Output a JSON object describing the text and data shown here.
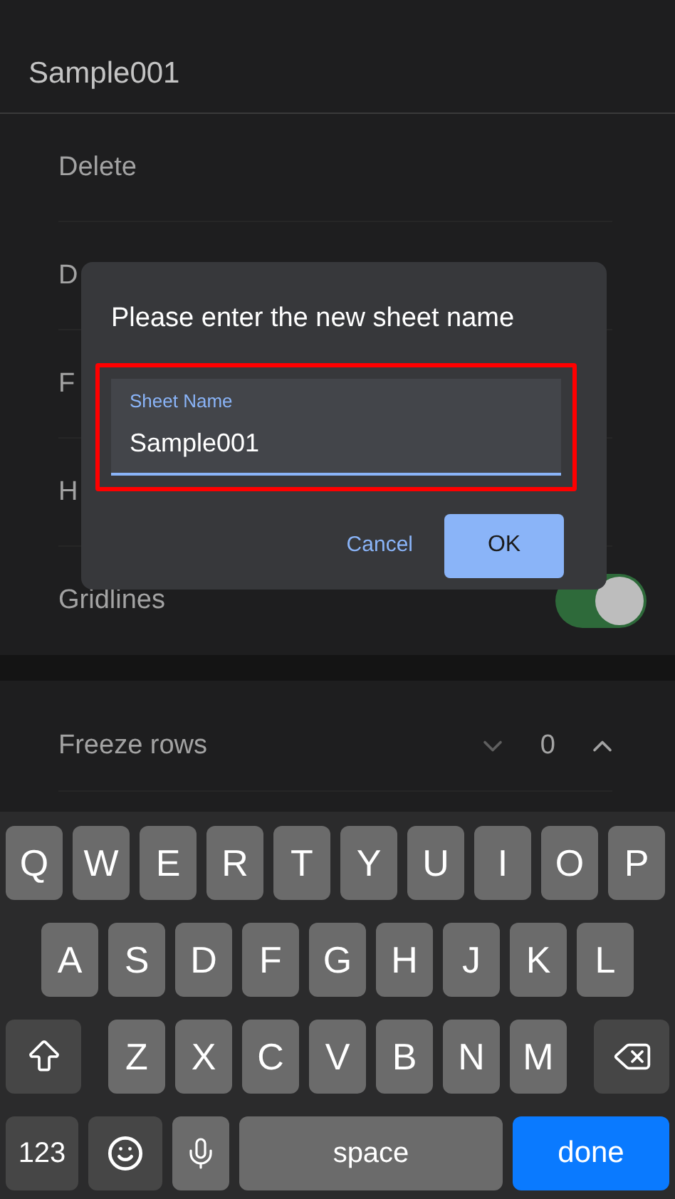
{
  "header": {
    "title": "Sample001"
  },
  "menu": [
    {
      "kind": "text",
      "label": "Delete"
    },
    {
      "kind": "text",
      "label": "D"
    },
    {
      "kind": "text",
      "label": "F"
    },
    {
      "kind": "text",
      "label": "H"
    },
    {
      "kind": "toggle",
      "label": "Gridlines",
      "on": true
    }
  ],
  "dialog": {
    "title": "Please enter the new sheet name",
    "highlighted": true,
    "field": {
      "label": "Sheet Name",
      "value": "Sample001"
    },
    "buttons": [
      {
        "kind": "text",
        "label": "Cancel"
      },
      {
        "kind": "filled",
        "label": "OK"
      }
    ]
  },
  "freeze_rows": {
    "label": "Freeze rows",
    "value": "0"
  },
  "keyboard": {
    "top_row": [
      {
        "kind": "letter",
        "label": "Q"
      },
      {
        "kind": "letter",
        "label": "W"
      },
      {
        "kind": "letter",
        "label": "E"
      },
      {
        "kind": "letter",
        "label": "R"
      },
      {
        "kind": "letter",
        "label": "T"
      },
      {
        "kind": "letter",
        "label": "Y"
      },
      {
        "kind": "letter",
        "label": "U"
      },
      {
        "kind": "letter",
        "label": "I"
      },
      {
        "kind": "letter",
        "label": "O"
      },
      {
        "kind": "letter",
        "label": "P"
      }
    ],
    "middle_row": [
      {
        "kind": "letter",
        "label": "A"
      },
      {
        "kind": "letter",
        "label": "S"
      },
      {
        "kind": "letter",
        "label": "D"
      },
      {
        "kind": "letter",
        "label": "F"
      },
      {
        "kind": "letter",
        "label": "G"
      },
      {
        "kind": "letter",
        "label": "H"
      },
      {
        "kind": "letter",
        "label": "J"
      },
      {
        "kind": "letter",
        "label": "K"
      },
      {
        "kind": "letter",
        "label": "L"
      }
    ],
    "lower_row": [
      {
        "kind": "shift"
      },
      {
        "kind": "letter",
        "label": "Z"
      },
      {
        "kind": "letter",
        "label": "X"
      },
      {
        "kind": "letter",
        "label": "C"
      },
      {
        "kind": "letter",
        "label": "V"
      },
      {
        "kind": "letter",
        "label": "B"
      },
      {
        "kind": "letter",
        "label": "N"
      },
      {
        "kind": "letter",
        "label": "M"
      },
      {
        "kind": "backspace"
      }
    ],
    "function_row": [
      {
        "kind": "numbers",
        "label": "123"
      },
      {
        "kind": "emoji"
      },
      {
        "kind": "mic"
      },
      {
        "kind": "space",
        "label": "space"
      },
      {
        "kind": "done",
        "label": "done"
      }
    ]
  }
}
